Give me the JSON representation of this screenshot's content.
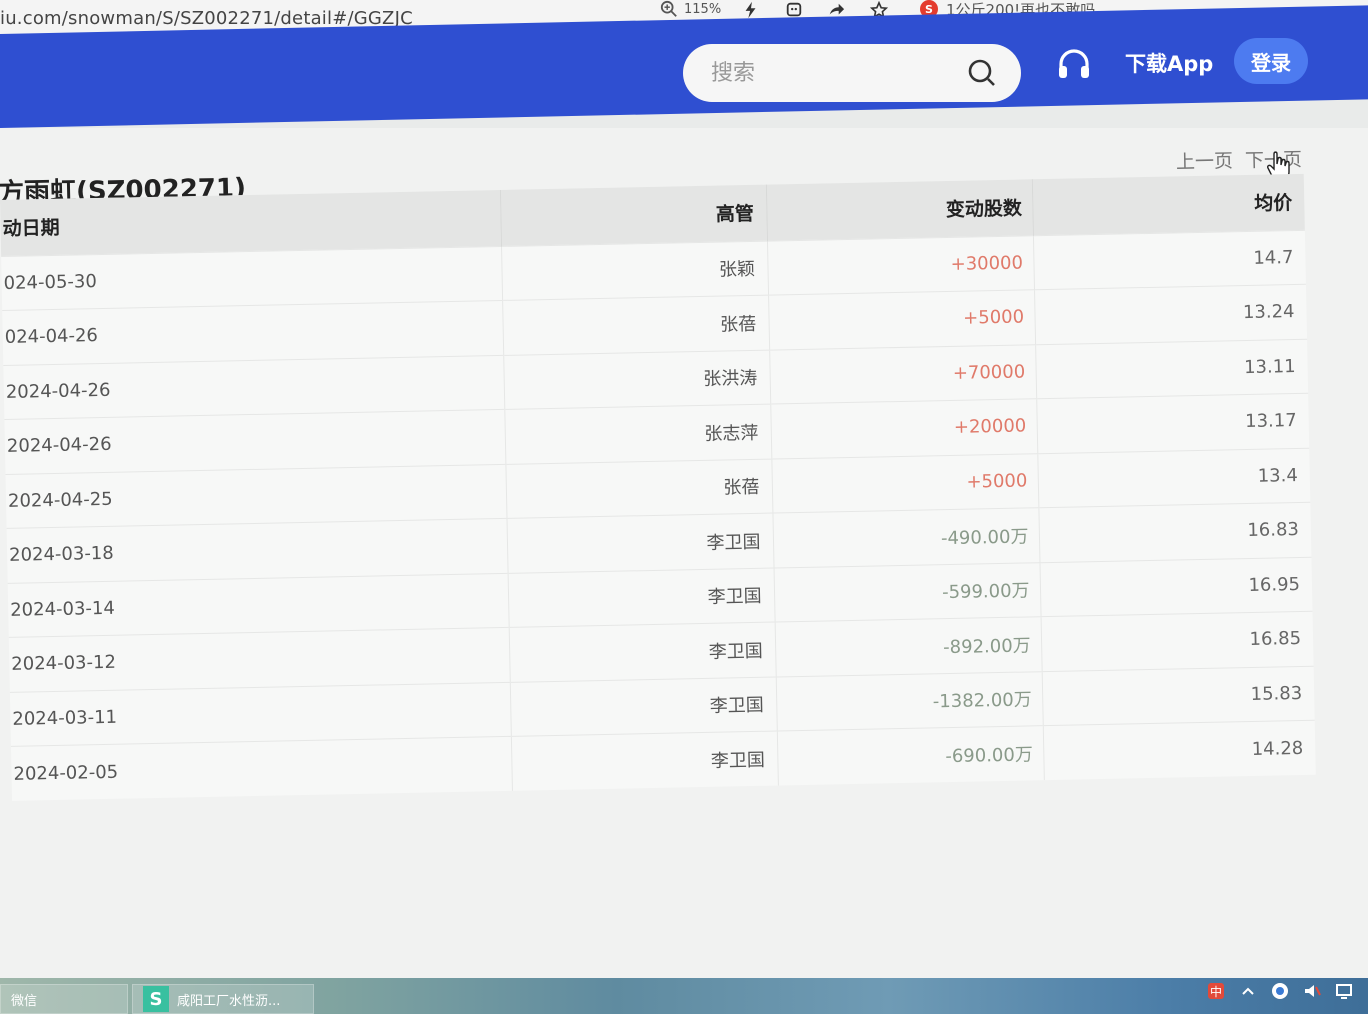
{
  "browser": {
    "url": "iu.com/snowman/S/SZ002271/detail#/GGZJC",
    "zoom": "115%",
    "tab_snippet": "1公斤200!再也不敢吗"
  },
  "header": {
    "search_placeholder": "搜索",
    "download_label": "下载App",
    "login_label": "登录",
    "brand_color": "#2f4fd1"
  },
  "page": {
    "title": "方雨虹(SZ002271)",
    "prev_page": "上一页",
    "next_page": "下一页"
  },
  "table": {
    "headers": [
      "动日期",
      "高管",
      "变动股数",
      "均价"
    ],
    "rows": [
      {
        "date": "024-05-30",
        "exec": "张颖",
        "change": "+30000",
        "price": "14.7"
      },
      {
        "date": "024-04-26",
        "exec": "张蓓",
        "change": "+5000",
        "price": "13.24"
      },
      {
        "date": "2024-04-26",
        "exec": "张洪涛",
        "change": "+70000",
        "price": "13.11"
      },
      {
        "date": "2024-04-26",
        "exec": "张志萍",
        "change": "+20000",
        "price": "13.17"
      },
      {
        "date": "2024-04-25",
        "exec": "张蓓",
        "change": "+5000",
        "price": "13.4"
      },
      {
        "date": "2024-03-18",
        "exec": "李卫国",
        "change": "-490.00万",
        "price": "16.83"
      },
      {
        "date": "2024-03-14",
        "exec": "李卫国",
        "change": "-599.00万",
        "price": "16.95"
      },
      {
        "date": "2024-03-12",
        "exec": "李卫国",
        "change": "-892.00万",
        "price": "16.85"
      },
      {
        "date": "2024-03-11",
        "exec": "李卫国",
        "change": "-1382.00万",
        "price": "15.83"
      },
      {
        "date": "2024-02-05",
        "exec": "李卫国",
        "change": "-690.00万",
        "price": "14.28"
      }
    ]
  },
  "taskbar": {
    "item1": "微信",
    "item2": "咸阳工厂水性沥..."
  }
}
